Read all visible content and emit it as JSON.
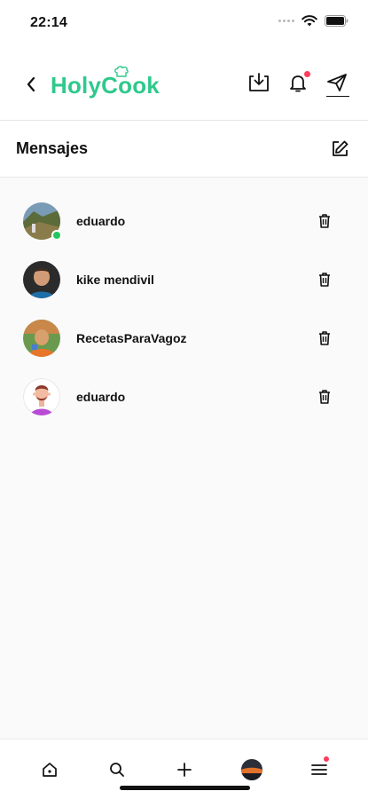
{
  "status": {
    "time": "22:14"
  },
  "header": {
    "logo_text": "HolyCook"
  },
  "section": {
    "title": "Mensajes"
  },
  "conversations": [
    {
      "name": "eduardo",
      "online": true
    },
    {
      "name": "kike mendivil",
      "online": false
    },
    {
      "name": "RecetasParaVagoz",
      "online": false
    },
    {
      "name": "eduardo",
      "online": false
    }
  ],
  "colors": {
    "brand": "#2fc98c",
    "notification": "#ff3b5c",
    "online": "#22c55e"
  }
}
